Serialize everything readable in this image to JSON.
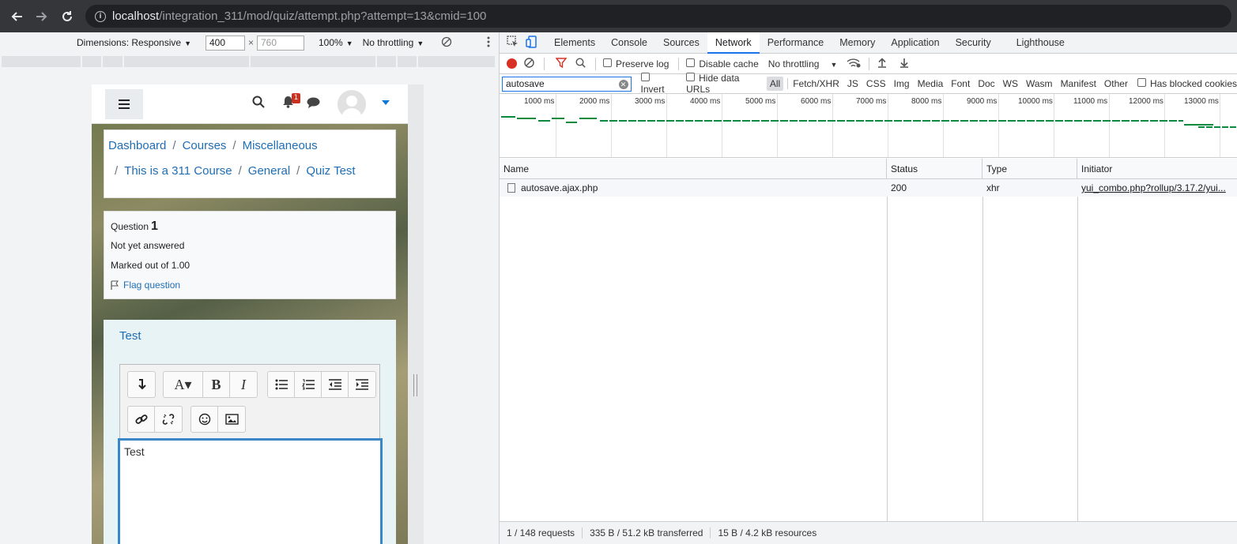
{
  "browser": {
    "url_host": "localhost",
    "url_path": "/integration_311/mod/quiz/attempt.php?attempt=13&cmid=100"
  },
  "device_toolbar": {
    "dimensions_label": "Dimensions: Responsive",
    "width": "400",
    "height_placeholder": "760",
    "times": "×",
    "zoom": "100%",
    "throttling": "No throttling"
  },
  "moodle": {
    "notification_count": "1",
    "breadcrumb": {
      "sep": "/",
      "dashboard": "Dashboard",
      "courses": "Courses",
      "misc": "Miscellaneous",
      "course": "This is a 311 Course",
      "general": "General",
      "quiz": "Quiz Test"
    },
    "question": {
      "label": "Question",
      "number": "1",
      "state": "Not yet answered",
      "marks": "Marked out of 1.00",
      "flag": "Flag question",
      "text": "Test",
      "answer": "Test"
    }
  },
  "devtools": {
    "tabs": [
      "Elements",
      "Console",
      "Sources",
      "Network",
      "Performance",
      "Memory",
      "Application",
      "Security",
      "Lighthouse"
    ],
    "active_tab": "Network",
    "toolbar": {
      "preserve_log": "Preserve log",
      "disable_cache": "Disable cache",
      "throttling": "No throttling"
    },
    "filter": {
      "value": "autosave",
      "invert": "Invert",
      "hide_data_urls": "Hide data URLs",
      "types": [
        "All",
        "Fetch/XHR",
        "JS",
        "CSS",
        "Img",
        "Media",
        "Font",
        "Doc",
        "WS",
        "Wasm",
        "Manifest",
        "Other"
      ],
      "blocked": "Has blocked cookies"
    },
    "timeline_labels": [
      "1000 ms",
      "2000 ms",
      "3000 ms",
      "4000 ms",
      "5000 ms",
      "6000 ms",
      "7000 ms",
      "8000 ms",
      "9000 ms",
      "10000 ms",
      "11000 ms",
      "12000 ms",
      "13000 ms"
    ],
    "columns": {
      "name": "Name",
      "status": "Status",
      "type": "Type",
      "initiator": "Initiator"
    },
    "rows": [
      {
        "name": "autosave.ajax.php",
        "status": "200",
        "type": "xhr",
        "initiator": "yui_combo.php?rollup/3.17.2/yui..."
      }
    ],
    "summary": {
      "requests": "1 / 148 requests",
      "transferred": "335 B / 51.2 kB transferred",
      "resources": "15 B / 4.2 kB resources"
    }
  }
}
